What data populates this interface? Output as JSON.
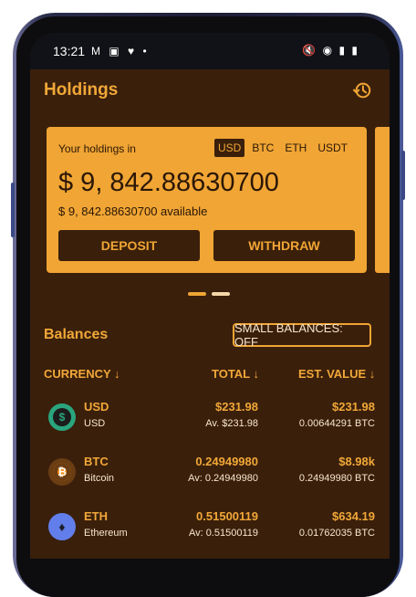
{
  "status": {
    "time": "13:21",
    "left_icons": "M ▣ ♥ •",
    "right_icons": "🔇 ◉ ▮ ▮"
  },
  "header": {
    "title": "Holdings",
    "history_icon": "history-icon"
  },
  "card": {
    "caption": "Your holdings in",
    "currencies": [
      "USD",
      "BTC",
      "ETH",
      "USDT"
    ],
    "active_currency": "USD",
    "amount": "$ 9, 842.88630700",
    "available": "$ 9, 842.88630700 available",
    "deposit_label": "DEPOSIT",
    "withdraw_label": "WITHDRAW"
  },
  "pager": {
    "pages": 2,
    "active": 1
  },
  "balances": {
    "title": "Balances",
    "small_balances_label": "SMALL BALANCES: OFF",
    "col_currency": "CURRENCY ↓",
    "col_total": "TOTAL ↓",
    "col_est": "EST. VALUE ↓",
    "rows": [
      {
        "symbol": "USD",
        "name": "USD",
        "total": "$231.98",
        "available": "Av. $231.98",
        "est_value": "$231.98",
        "est_btc": "0.00644291 BTC",
        "icon": "dollar-icon",
        "icon_color": "#2aa57d",
        "icon_glyph": "$"
      },
      {
        "symbol": "BTC",
        "name": "Bitcoin",
        "total": "0.24949980",
        "available": "Av: 0.24949980",
        "est_value": "$8.98k",
        "est_btc": "0.24949980 BTC",
        "icon": "bitcoin-icon",
        "icon_color": "#f7931a",
        "icon_glyph": "₿"
      },
      {
        "symbol": "ETH",
        "name": "Ethereum",
        "total": "0.51500119",
        "available": "Av: 0.51500119",
        "est_value": "$634.19",
        "est_btc": "0.01762035 BTC",
        "icon": "ethereum-icon",
        "icon_color": "#627eea",
        "icon_glyph": "♦"
      }
    ]
  },
  "colors": {
    "accent": "#f0a534",
    "background": "#3a1f0b",
    "text_light": "#f7e6cc"
  }
}
